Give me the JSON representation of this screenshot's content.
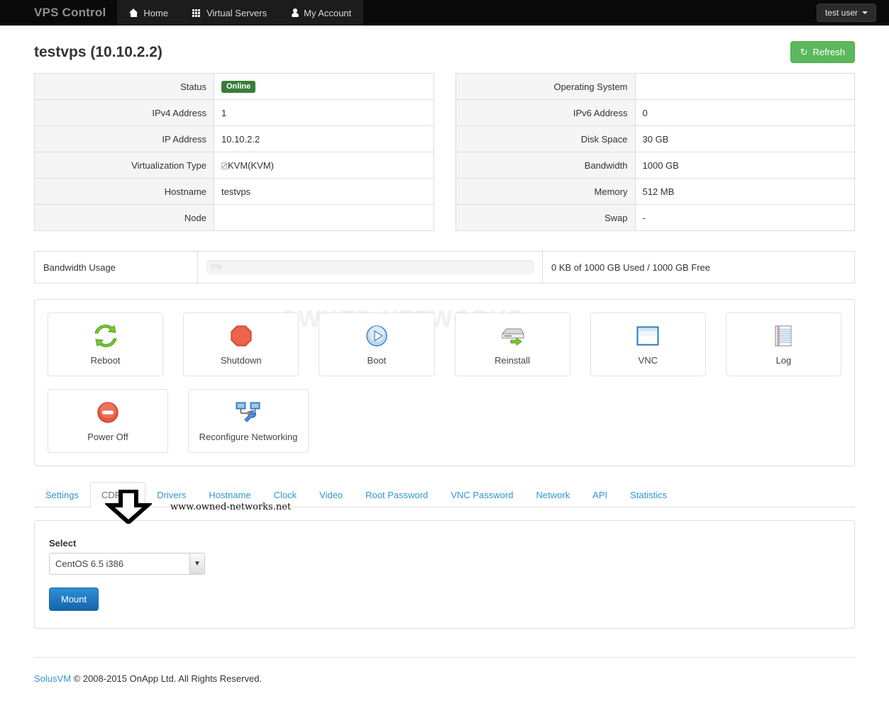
{
  "navbar": {
    "brand": "VPS Control",
    "items": [
      {
        "label": "Home",
        "icon": "home-icon"
      },
      {
        "label": "Virtual Servers",
        "icon": "grid-icon"
      },
      {
        "label": "My Account",
        "icon": "user-icon"
      }
    ],
    "user_menu": {
      "label": "test user"
    }
  },
  "page": {
    "title": "testvps (10.10.2.2)",
    "refresh_label": "Refresh",
    "refresh_icon": "refresh-icon",
    "accent_green": "#5cb85c",
    "accent_blue": "#3097d1"
  },
  "info_left": [
    {
      "key": "Status",
      "value": "Online",
      "type": "badge"
    },
    {
      "key": "IPv4 Address",
      "value": "1",
      "type": "text"
    },
    {
      "key": "IP Address",
      "value": "10.10.2.2",
      "type": "text"
    },
    {
      "key": "Virtualization Type",
      "value": "KVM(KVM)",
      "type": "broken-image-text"
    },
    {
      "key": "Hostname",
      "value": "testvps",
      "type": "text"
    },
    {
      "key": "Node",
      "value": "",
      "type": "text"
    }
  ],
  "info_right": [
    {
      "key": "Operating System",
      "value": "",
      "type": "text"
    },
    {
      "key": "IPv6 Address",
      "value": "0",
      "type": "text"
    },
    {
      "key": "Disk Space",
      "value": "30 GB",
      "type": "text"
    },
    {
      "key": "Bandwidth",
      "value": "1000 GB",
      "type": "text"
    },
    {
      "key": "Memory",
      "value": "512 MB",
      "type": "text"
    },
    {
      "key": "Swap",
      "value": "-",
      "type": "text"
    }
  ],
  "bandwidth": {
    "label": "Bandwidth Usage",
    "percent_text": "0%",
    "percent_value": 0,
    "summary": "0 KB of 1000 GB Used / 1000 GB Free"
  },
  "actions": {
    "watermark": "OWNED-NETWORKS",
    "row1": [
      {
        "label": "Reboot",
        "icon": "reboot-icon"
      },
      {
        "label": "Shutdown",
        "icon": "stop-octagon-icon"
      },
      {
        "label": "Boot",
        "icon": "play-circle-icon"
      },
      {
        "label": "Reinstall",
        "icon": "server-arrow-icon"
      },
      {
        "label": "VNC",
        "icon": "window-icon"
      },
      {
        "label": "Log",
        "icon": "notebook-icon"
      }
    ],
    "row2": [
      {
        "label": "Power Off",
        "icon": "power-off-icon"
      },
      {
        "label": "Reconfigure Networking",
        "icon": "network-wrench-icon"
      }
    ]
  },
  "annotation": {
    "arrow_icon": "down-arrow-annotation-icon",
    "url": "www.owned-networks.net"
  },
  "tabs": {
    "items": [
      "Settings",
      "CDRom",
      "Drivers",
      "Hostname",
      "Clock",
      "Video",
      "Root Password",
      "VNC Password",
      "Network",
      "API",
      "Statistics"
    ],
    "active_index": 1
  },
  "cdrom_panel": {
    "select_label": "Select",
    "select_value": "CentOS 6.5 i386",
    "select_caret": "⌄",
    "mount_label": "Mount"
  },
  "footer": {
    "link": "SolusVM",
    "text": " © 2008-2015 OnApp Ltd. All Rights Reserved."
  }
}
